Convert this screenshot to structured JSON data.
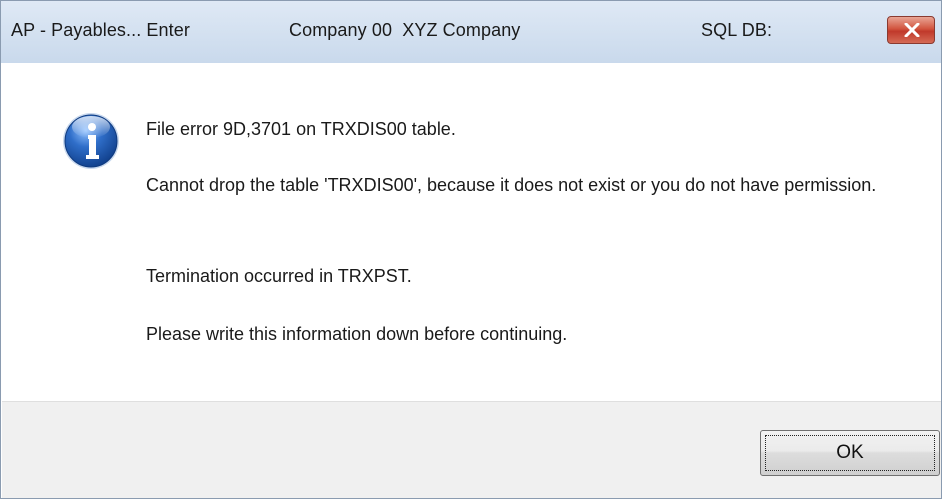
{
  "window": {
    "title_app": "AP - Payables... Enter",
    "title_company": "Company 00  XYZ Company",
    "title_sql": "SQL DB:",
    "close_icon": "close-icon"
  },
  "dialog": {
    "icon": "info-icon",
    "line1": "File error 9D,3701 on TRXDIS00 table.",
    "line2": "Cannot drop the table 'TRXDIS00', because it does not exist or you do not have permission.",
    "line3": "Termination occurred in TRXPST.",
    "line4": "Please write this information down before continuing."
  },
  "buttons": {
    "ok_label": "OK"
  },
  "colors": {
    "titlebar": "#c9d9ec",
    "close_button": "#c0392b",
    "footer": "#f0f0f0",
    "info_icon": "#2f6ec9"
  }
}
